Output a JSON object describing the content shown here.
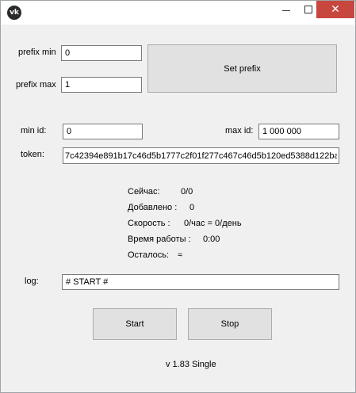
{
  "titlebar": {
    "app_icon_glyph": "vk",
    "close_glyph": "✕"
  },
  "prefix": {
    "min_label": "prefix min",
    "min_value": "0",
    "max_label": "prefix max",
    "max_value": "1",
    "set_button": "Set prefix"
  },
  "ids": {
    "min_label": "min id:",
    "min_value": "0",
    "max_label": "max id:",
    "max_value": "1 000 000"
  },
  "token": {
    "label": "token:",
    "value": "7c42394e891b17c46d5b1777c2f01f277c467c46d5b120ed5388d122ba"
  },
  "stats": {
    "now_label": "Сейчас:",
    "now_value": "0/0",
    "added_label": "Добавлено :",
    "added_value": "0",
    "speed_label": "Скорость :",
    "speed_value": "0/час = 0/день",
    "uptime_label": "Время работы :",
    "uptime_value": "0:00",
    "left_label": "Осталось:",
    "left_value": "≈"
  },
  "log": {
    "label": "log:",
    "value": "# START #"
  },
  "buttons": {
    "start": "Start",
    "stop": "Stop"
  },
  "version": "v 1.83 Single",
  "colors": {
    "close_button": "#c7463e",
    "window_bg": "#f0f0f0"
  }
}
